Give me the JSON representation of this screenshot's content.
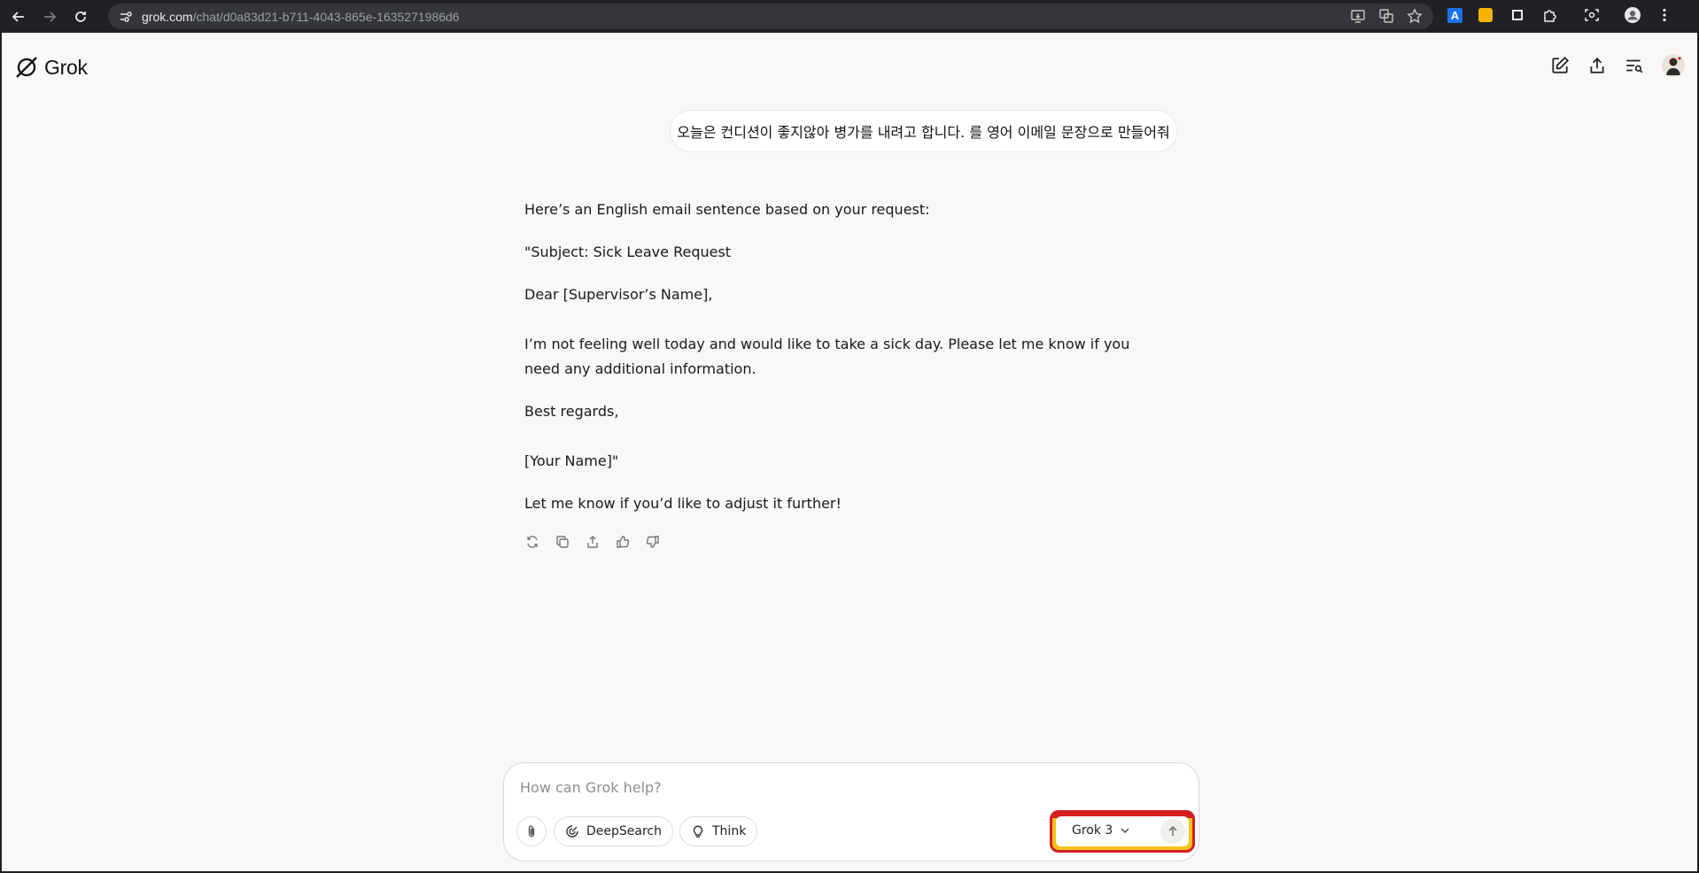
{
  "browser": {
    "url_host": "grok.com",
    "url_path": "/chat/d0a83d21-b711-4043-865e-1635271986d6"
  },
  "app": {
    "logo_text": "Grok"
  },
  "conversation": {
    "user_message": "오늘은 컨디션이 좋지않아 병가를 내려고 합니다. 를 영어 이메일 문장으로 만들어줘",
    "assistant_paragraphs": [
      "Here’s an English email sentence based on your request:",
      "\"Subject: Sick Leave Request",
      "Dear [Supervisor’s Name],",
      "I’m not feeling well today and would like to take a sick day. Please let me know if you need any additional information.",
      "Best regards,",
      "[Your Name]\"",
      "Let me know if you’d like to adjust it further!"
    ]
  },
  "composer": {
    "placeholder": "How can Grok help?",
    "deepsearch_label": "DeepSearch",
    "think_label": "Think",
    "model_label": "Grok 3"
  },
  "colors": {
    "highlight_border": "#d41f1f",
    "highlight_fill": "#f7c21b",
    "page_background": "#f9f8f6"
  }
}
